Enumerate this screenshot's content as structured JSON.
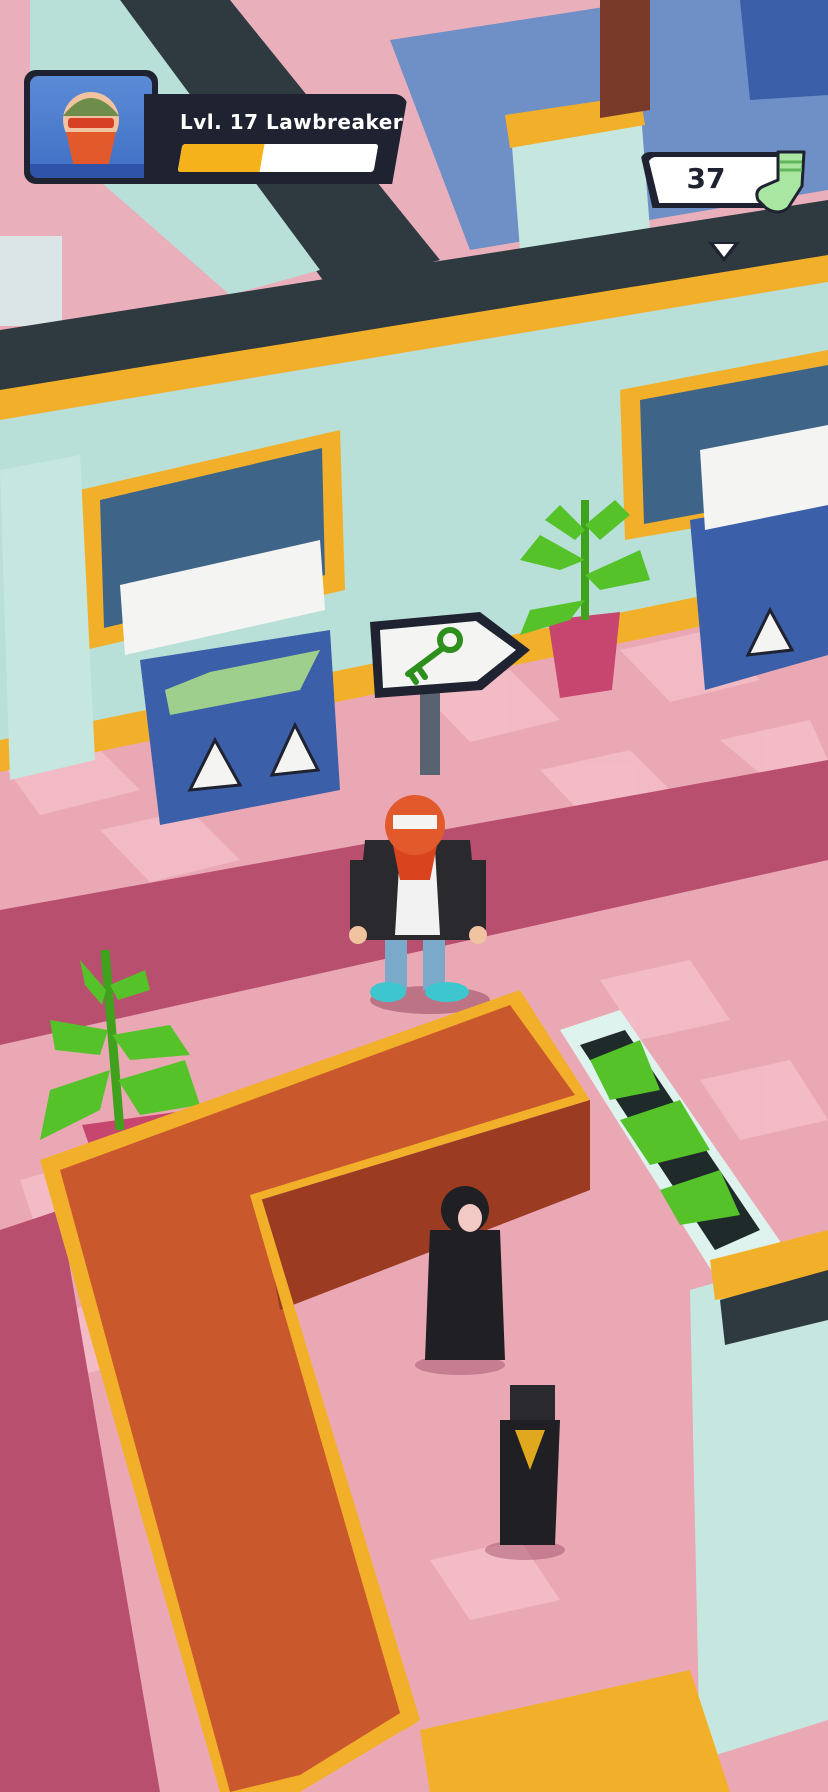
{
  "hud": {
    "level_label": "Lvl. 17 Lawbreaker",
    "xp_progress": 0.42,
    "currency_value": "37",
    "currency_icon": "sock-icon",
    "portrait_icon": "bearded-character-avatar",
    "indicator_icon": "arrow-down-icon"
  },
  "world": {
    "sign_icon": "key-icon",
    "colors": {
      "floor_pink": "#e6a3b0",
      "wall_mint": "#b8e0d8",
      "gold_trim": "#f2b02a",
      "counter_orange": "#c9592d",
      "dark_wall": "#2f3a40",
      "container_blue": "#3b5fa8",
      "plant_green": "#56c22a",
      "pot_pink": "#c64670"
    }
  }
}
